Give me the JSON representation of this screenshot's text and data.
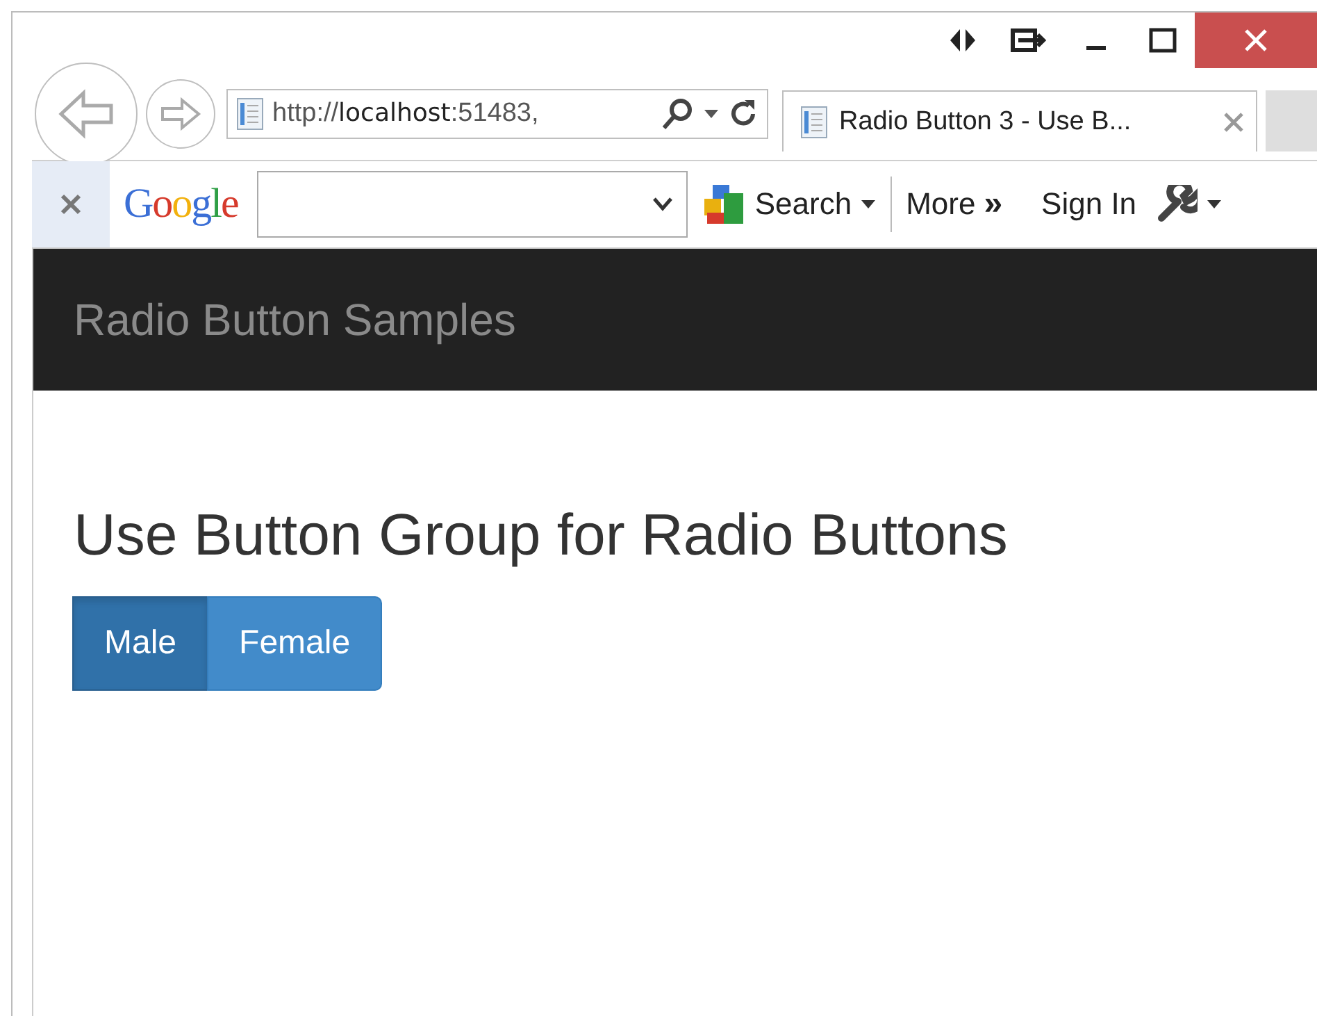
{
  "browser": {
    "address": "http://**localhost**:51483,",
    "tab_title": "Radio Button 3 - Use B...",
    "toolbar": {
      "logo": "Google",
      "search_label": "Search",
      "more_label": "More",
      "more_glyph": "»",
      "sign_in": "Sign In"
    }
  },
  "navbar": {
    "brand": "Radio Button Samples"
  },
  "page": {
    "heading": "Use Button Group for Radio Buttons",
    "options": [
      {
        "label": "Male",
        "selected": true
      },
      {
        "label": "Female",
        "selected": false
      }
    ]
  }
}
